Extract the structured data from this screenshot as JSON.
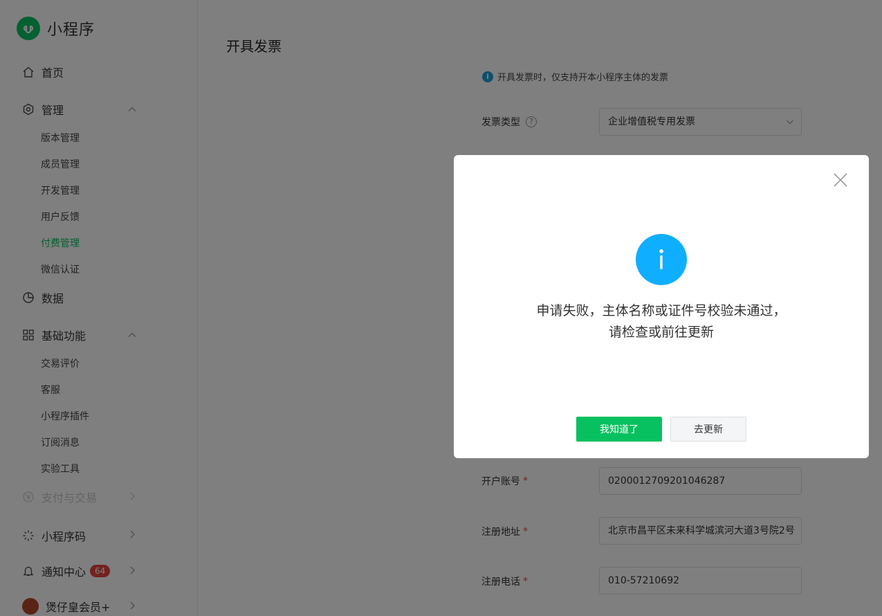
{
  "brand": {
    "name": "小程序",
    "accent": "#07c160"
  },
  "sidebar": {
    "home": "首页",
    "manage": {
      "label": "管理",
      "items": [
        "版本管理",
        "成员管理",
        "开发管理",
        "用户反馈",
        "付费管理",
        "微信认证"
      ],
      "active": "付费管理"
    },
    "data": "数据",
    "basic": {
      "label": "基础功能",
      "items": [
        "交易评价",
        "客服",
        "小程序插件",
        "订阅消息",
        "实验工具"
      ]
    },
    "payment": "支付与交易",
    "qrcode": "小程序码",
    "notify": {
      "label": "通知中心",
      "count": "64"
    },
    "account": "煲仔皇会员+"
  },
  "page": {
    "title": "开具发票",
    "tip": "开具发票时，仅支持开本小程序主体的发票",
    "invoice_type": {
      "label": "发票类型",
      "value": "企业增值税专用发票"
    },
    "bank_account": {
      "label": "开户账号",
      "value": "0200012709201046287"
    },
    "address": {
      "label": "注册地址",
      "value": "北京市昌平区未来科学城滨河大道3号院2号"
    },
    "phone": {
      "label": "注册电话",
      "value": "010-57210692"
    },
    "required_mark": "*"
  },
  "modal": {
    "message_line1": "申请失败，主体名称或证件号校验未通过，",
    "message_line2": "请检查或前往更新",
    "confirm_label": "我知道了",
    "update_label": "去更新",
    "info_color": "#10aeff"
  }
}
